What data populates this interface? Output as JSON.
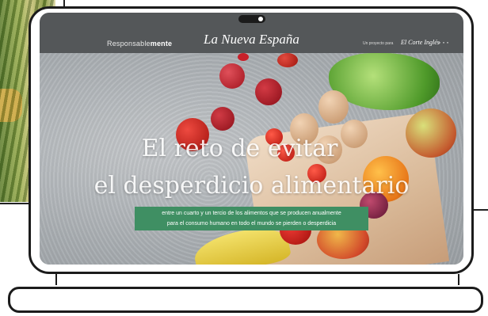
{
  "header": {
    "section_prefix": "Responsable",
    "section_suffix": "mente",
    "logo": "La Nueva España",
    "project_label": "Un proyecto para",
    "brand": "El Corte Inglés",
    "menu_icon": "more-dots-icon",
    "menu_glyph": "···"
  },
  "hero": {
    "title_line1": "El reto de evitar",
    "title_line2": "el desperdicio alimentario",
    "subtitle_line1": "entre un cuarto y un tercio de los alimentos que se producen anualmente",
    "subtitle_line2": "para el consumo humano en todo el mundo se pierden o desperdicia",
    "subtitle_bg": "#3f8f63"
  }
}
